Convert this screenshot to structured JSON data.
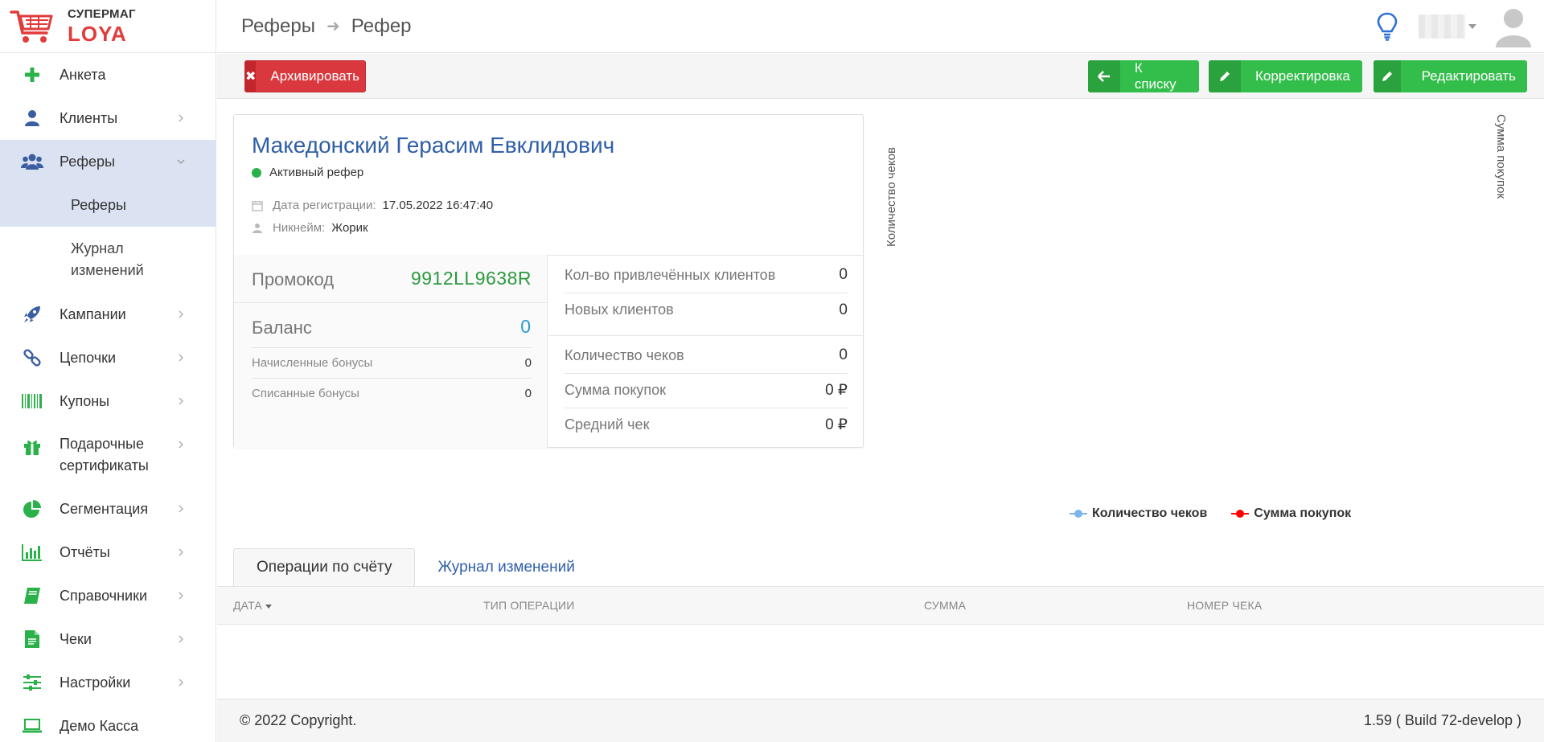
{
  "logo": {
    "top": "СУПЕРМАГ",
    "bottom": "LOYA"
  },
  "sidebar": {
    "items": [
      {
        "label": "Анкета",
        "icon": "plus-icon",
        "chevron": false
      },
      {
        "label": "Клиенты",
        "icon": "user-icon",
        "chevron": true
      },
      {
        "label": "Реферы",
        "icon": "users-icon",
        "chevron": true,
        "active": true
      },
      {
        "label": "Кампании",
        "icon": "rocket-icon",
        "chevron": true
      },
      {
        "label": "Цепочки",
        "icon": "link-icon",
        "chevron": true
      },
      {
        "label": "Купоны",
        "icon": "barcode-icon",
        "chevron": true
      },
      {
        "label": "Подарочные сертификаты",
        "icon": "gift-icon",
        "chevron": true
      },
      {
        "label": "Сегментация",
        "icon": "pie-chart-icon",
        "chevron": true
      },
      {
        "label": "Отчёты",
        "icon": "bar-chart-icon",
        "chevron": true
      },
      {
        "label": "Справочники",
        "icon": "book-icon",
        "chevron": true
      },
      {
        "label": "Чеки",
        "icon": "file-icon",
        "chevron": true
      },
      {
        "label": "Настройки",
        "icon": "sliders-icon",
        "chevron": true
      },
      {
        "label": "Демо Касса",
        "icon": "laptop-icon",
        "chevron": false
      }
    ],
    "sub_items": [
      {
        "label": "Реферы",
        "active": true
      },
      {
        "label": "Журнал изменений"
      }
    ]
  },
  "header": {
    "breadcrumb": [
      "Реферы",
      "Рефер"
    ]
  },
  "toolbar": {
    "archive_label": "Архивировать",
    "back_label": "К списку",
    "correct_label": "Корректировка",
    "edit_label": "Редактировать"
  },
  "referrer": {
    "name": "Македонский Герасим Евклидович",
    "status": "Активный рефер",
    "reg_label": "Дата регистрации:",
    "reg_value": "17.05.2022 16:47:40",
    "nick_label": "Никнейм:",
    "nick_value": "Жорик",
    "promo_label": "Промокод",
    "promo_value": "9912LL9638R",
    "balance_label": "Баланс",
    "balance_value": "0",
    "accrued_label": "Начисленные бонусы",
    "accrued_value": "0",
    "written_label": "Списанные бонусы",
    "written_value": "0",
    "stats": {
      "attracted_label": "Кол-во привлечённых клиентов",
      "attracted_value": "0",
      "new_label": "Новых клиентов",
      "new_value": "0",
      "checks_label": "Количество чеков",
      "checks_value": "0",
      "sum_label": "Сумма покупок",
      "sum_value": "0 ₽",
      "avg_label": "Средний чек",
      "avg_value": "0 ₽"
    }
  },
  "chart_data": {
    "type": "line",
    "ylabel": "Количество чеков",
    "y2label": "Сумма покупок",
    "series": [
      {
        "name": "Количество чеков",
        "color": "#7cb5ec",
        "values": []
      },
      {
        "name": "Сумма покупок",
        "color": "#ff0000",
        "values": []
      }
    ],
    "legend_position": "bottom"
  },
  "tabs": [
    {
      "label": "Операции по счёту",
      "active": true
    },
    {
      "label": "Журнал изменений",
      "active": false
    }
  ],
  "table": {
    "columns": [
      "ДАТА",
      "ТИП ОПЕРАЦИИ",
      "СУММА",
      "НОМЕР ЧЕКА"
    ],
    "rows": []
  },
  "footer": {
    "copyright": "© 2022 Copyright.",
    "version": "1.59 ( Build 72-develop )"
  },
  "colors": {
    "accent_green": "#33bd4b",
    "accent_red": "#d9383e",
    "link_blue": "#2f5ea8",
    "active_bg": "#dbe3f2"
  }
}
